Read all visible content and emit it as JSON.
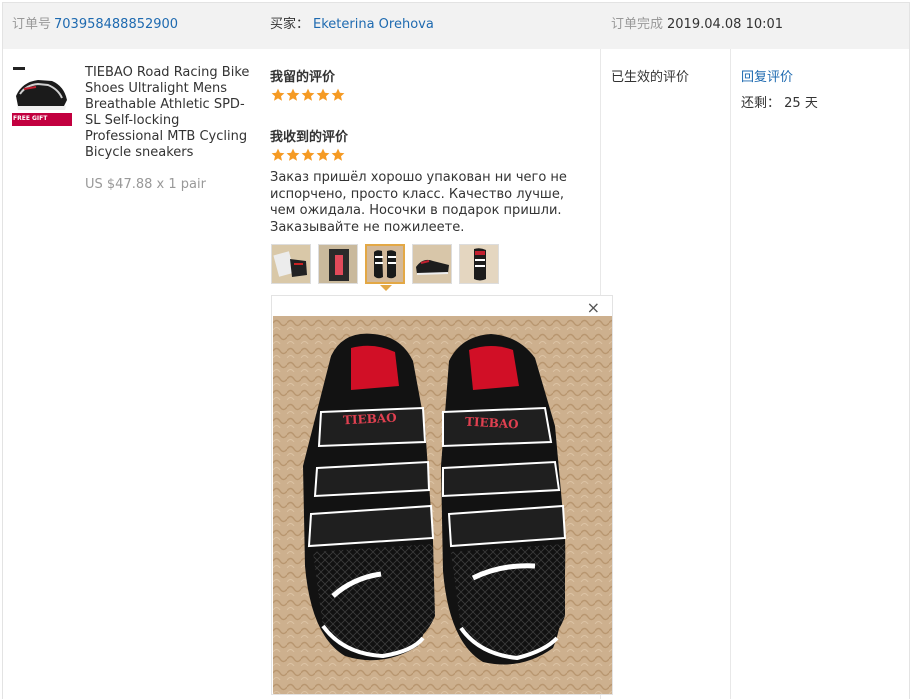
{
  "header": {
    "order_label": "订单号",
    "order_number": "703958488852900",
    "buyer_label": "买家：",
    "buyer_name": "Eketerina Orehova",
    "completed_label": "订单完成",
    "completed_time": "2019.04.08 10:01"
  },
  "product": {
    "title": "TIEBAO Road Racing Bike Shoes Ultralight Mens Breathable Athletic SPD-SL Self-locking Professional MTB Cycling Bicycle sneakers",
    "price": "US $47.88 x 1 pair",
    "thumb_badge": "FREE GIFT"
  },
  "my_review": {
    "title": "我留的评价",
    "rating": 5
  },
  "received_review": {
    "title": "我收到的评价",
    "rating": 5,
    "text": "Заказ пришёл хорошо упакован ни чего не испорчено, просто класс. Качество лучше, чем ожидала. Носочки в подарок пришли. Заказывайте не пожилеете."
  },
  "photos": {
    "count": 5,
    "selected_index": 2,
    "close_label": "×",
    "shoe_brand_text": "TIEBAO"
  },
  "status": {
    "label": "已生效的评价"
  },
  "actions": {
    "reply_label": "回复评价",
    "remaining_label": "还剩：",
    "remaining_value": "25 天"
  },
  "colors": {
    "link": "#1e6ab0",
    "star": "#f59a23",
    "active_border": "#e3a845",
    "header_bg": "#f2f2f2"
  }
}
